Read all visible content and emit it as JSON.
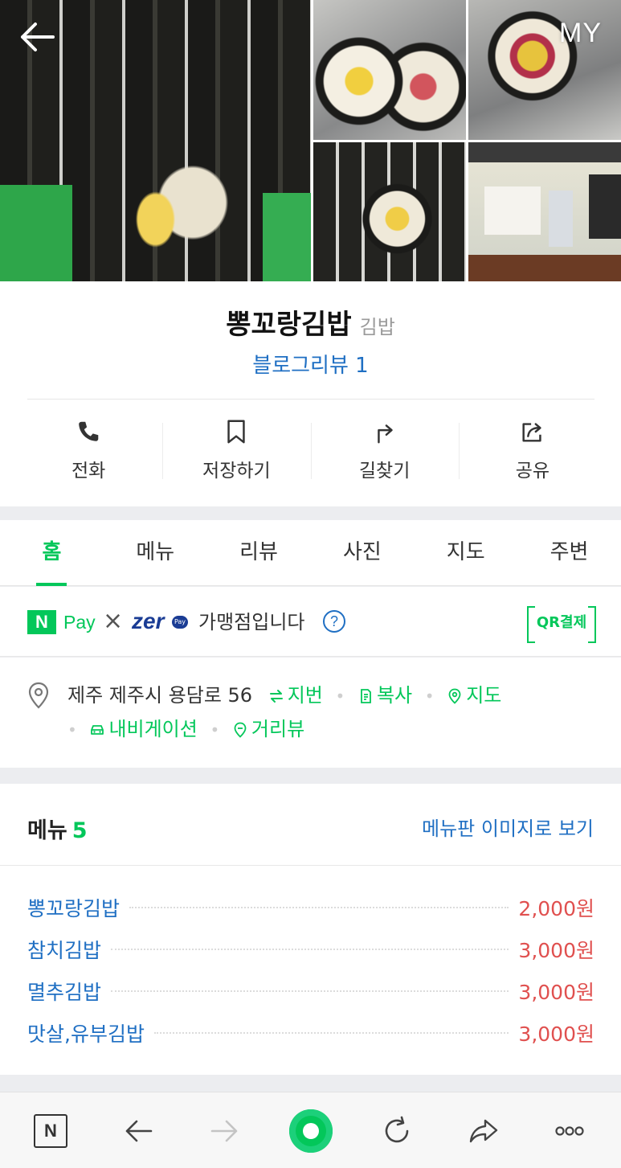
{
  "header": {
    "back_label": "back",
    "my_label": "MY"
  },
  "place": {
    "name": "뽕꼬랑김밥",
    "category": "김밥",
    "blog_review": "블로그리뷰 1"
  },
  "actions": [
    {
      "label": "전화",
      "icon": "phone-icon"
    },
    {
      "label": "저장하기",
      "icon": "bookmark-icon"
    },
    {
      "label": "길찾기",
      "icon": "directions-icon"
    },
    {
      "label": "공유",
      "icon": "share-icon"
    }
  ],
  "tabs": [
    {
      "label": "홈",
      "active": true
    },
    {
      "label": "메뉴"
    },
    {
      "label": "리뷰"
    },
    {
      "label": "사진"
    },
    {
      "label": "지도"
    },
    {
      "label": "주변"
    }
  ],
  "pay": {
    "npay_logo": "N",
    "npay_text": "Pay",
    "times": "×",
    "zero_text": "zer",
    "zero_pay_badge": "Pay",
    "merchant_text": "가맹점입니다",
    "help": "?",
    "qr_label": "QR결제"
  },
  "address": {
    "text": "제주 제주시 용담로 56",
    "jibun": "지번",
    "copy": "복사",
    "map": "지도",
    "navigation": "내비게이션",
    "street_view": "거리뷰"
  },
  "menu": {
    "title": "메뉴",
    "count": "5",
    "board_link": "메뉴판 이미지로 보기",
    "items": [
      {
        "name": "뽕꼬랑김밥",
        "price": "2,000원"
      },
      {
        "name": "참치김밥",
        "price": "3,000원"
      },
      {
        "name": "멸추김밥",
        "price": "3,000원"
      },
      {
        "name": "맛살,유부김밥",
        "price": "3,000원"
      }
    ]
  },
  "toolbar": {
    "home_label": "N"
  },
  "colors": {
    "naver_green": "#03c75a",
    "link_blue": "#1f6fc3",
    "price_red": "#e0504f"
  }
}
